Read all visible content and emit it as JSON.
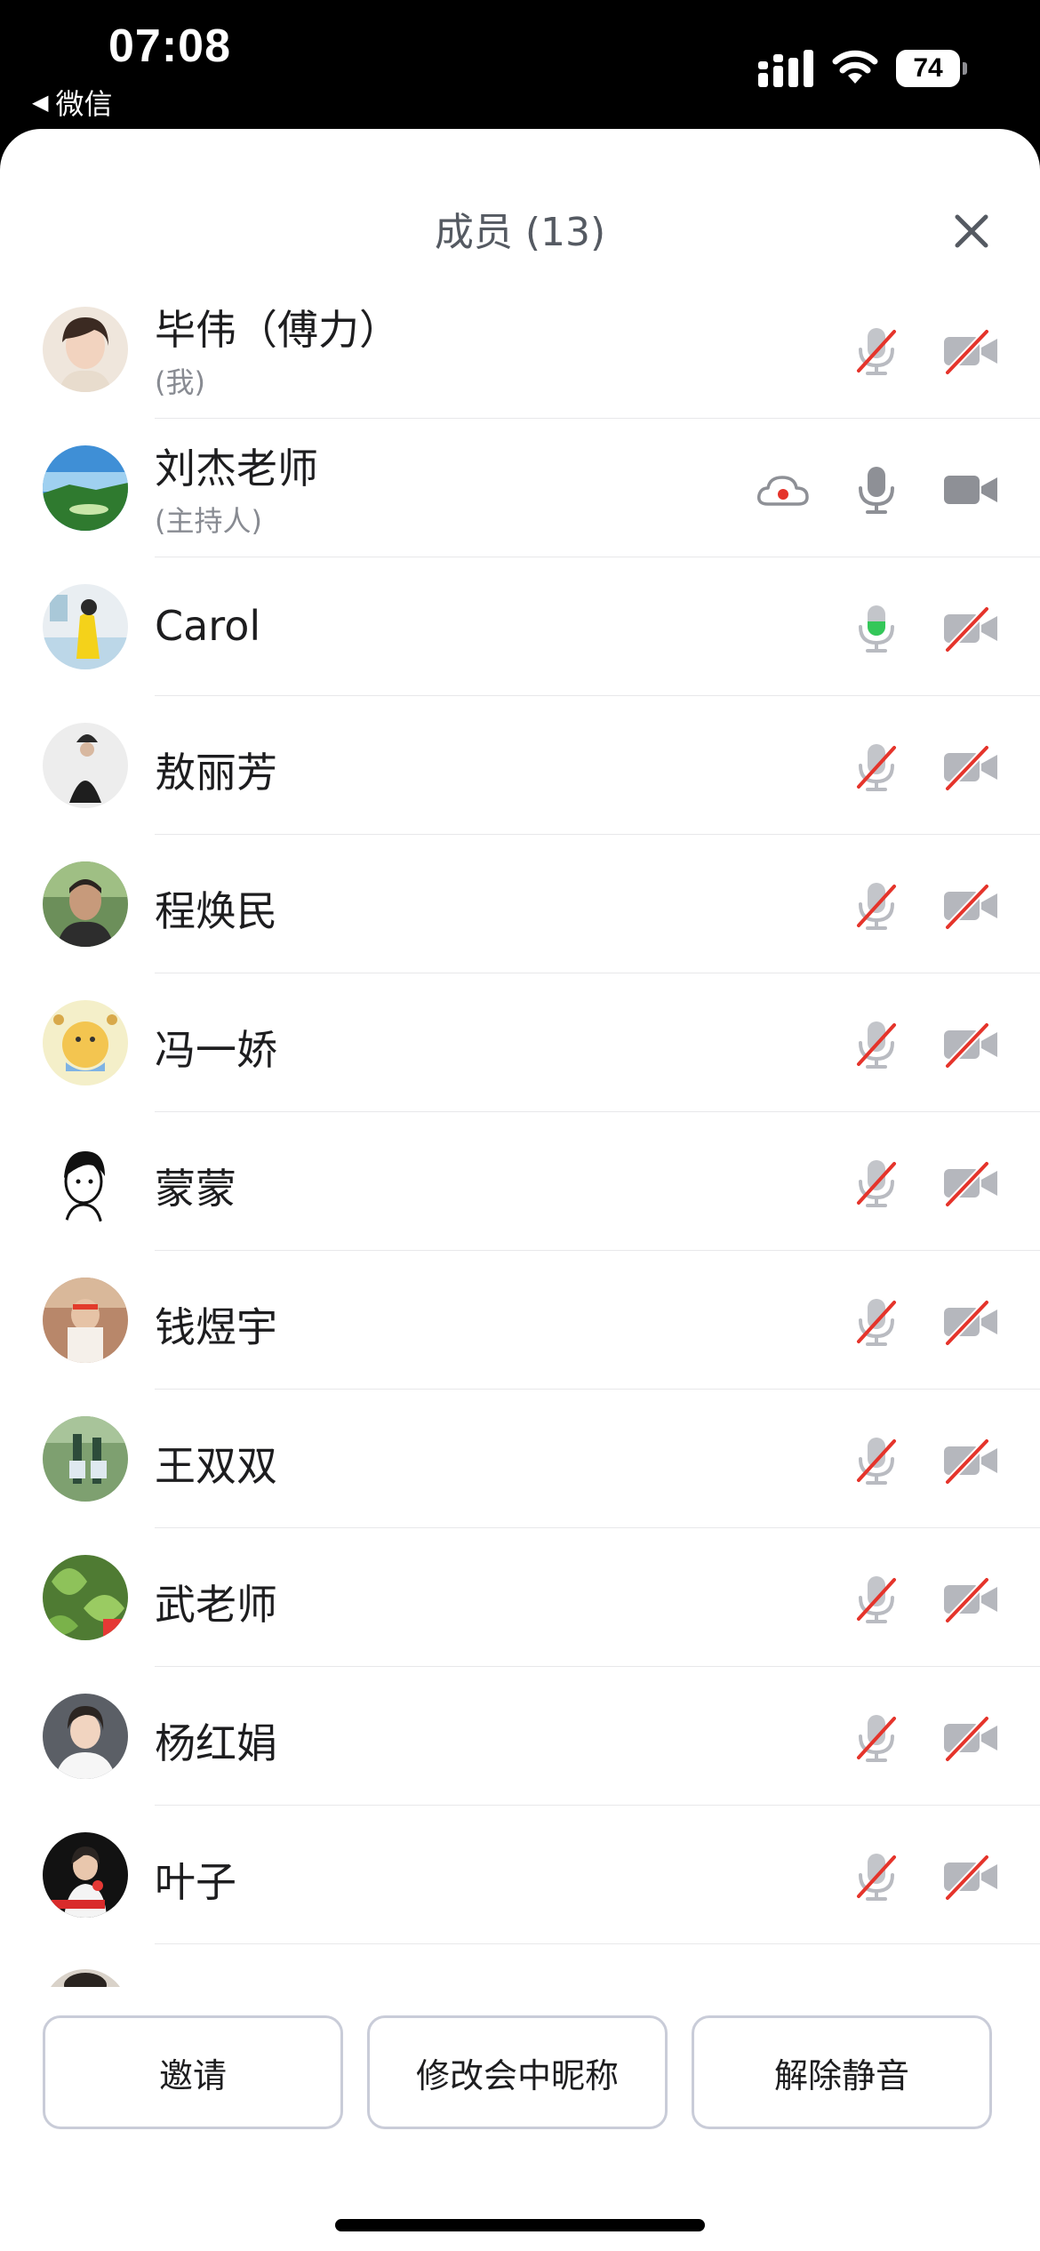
{
  "status_bar": {
    "time": "07:08",
    "back_label": "微信",
    "battery": "74",
    "icons": [
      "signal-icon",
      "wifi-icon",
      "battery-icon"
    ]
  },
  "header": {
    "title": "成员 (13)",
    "close_icon": "close-icon"
  },
  "members": [
    {
      "name": "毕伟（傅力）",
      "sub": "(我)",
      "mic": "muted",
      "cam": "off"
    },
    {
      "name": "刘杰老师",
      "sub": "(主持人)",
      "recording": true,
      "mic": "on",
      "cam": "on"
    },
    {
      "name": "Carol",
      "mic": "speaking",
      "cam": "off"
    },
    {
      "name": "敖丽芳",
      "mic": "muted",
      "cam": "off"
    },
    {
      "name": "程焕民",
      "mic": "muted",
      "cam": "off"
    },
    {
      "name": "冯一娇",
      "mic": "muted",
      "cam": "off"
    },
    {
      "name": "蒙蒙",
      "mic": "muted",
      "cam": "off"
    },
    {
      "name": "钱煜宇",
      "mic": "muted",
      "cam": "off"
    },
    {
      "name": "王双双",
      "mic": "muted",
      "cam": "off"
    },
    {
      "name": "武老师",
      "mic": "muted",
      "cam": "off"
    },
    {
      "name": "杨红娟",
      "mic": "muted",
      "cam": "off"
    },
    {
      "name": "叶子",
      "mic": "muted",
      "cam": "off"
    }
  ],
  "actions": {
    "invite": "邀请",
    "rename": "修改会中昵称",
    "unmute": "解除静音"
  },
  "colors": {
    "accent_red": "#e5342b",
    "icon_gray": "#8e9096",
    "speaking_green": "#34c759"
  }
}
